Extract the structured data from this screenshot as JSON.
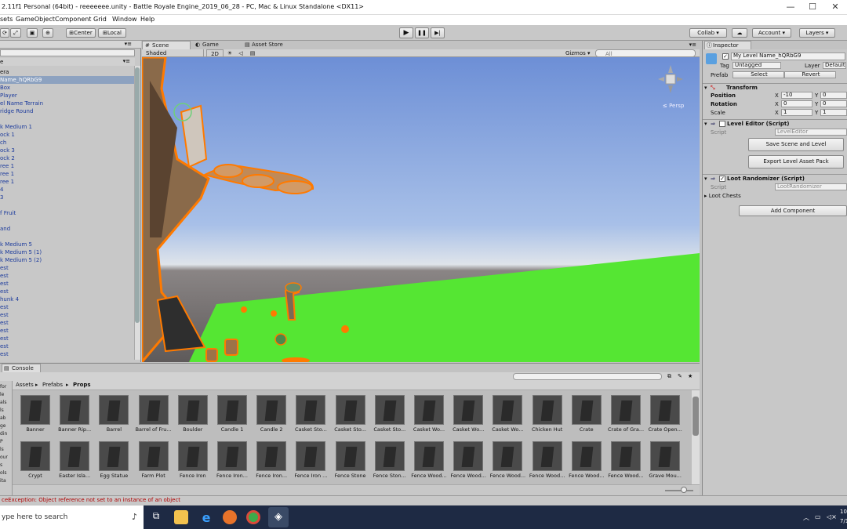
{
  "window": {
    "title": "2.11f1 Personal (64bit) - reeeeeee.unity - Battle Royale Engine_2019_06_28 - PC, Mac & Linux Standalone <DX11>",
    "min": "—",
    "max": "☐",
    "close": "✕"
  },
  "menu": [
    "sets",
    "GameObject",
    "Component",
    "Grid",
    "Window",
    "Help"
  ],
  "toolbar": {
    "center": "Center",
    "local": "Local",
    "play": "▶",
    "pause": "❚❚",
    "step": "▶|",
    "collab": "Collab ▾",
    "cloud": "☁",
    "account": "Account ▾",
    "layers": "Layers ▾"
  },
  "hierarchy": {
    "header": "e",
    "menu_glyph": "▾≡",
    "rows": [
      {
        "text": "era",
        "color": "black"
      },
      {
        "text": "Name_hQRbG9",
        "color": "selected"
      },
      {
        "text": "Box",
        "color": "blue"
      },
      {
        "text": "Player",
        "color": "blue"
      },
      {
        "text": "el Name Terrain",
        "color": "blue"
      },
      {
        "text": "ridge Round",
        "color": "blue"
      },
      {
        "text": "",
        "color": "blue"
      },
      {
        "text": "k Medium 1",
        "color": "blue"
      },
      {
        "text": "ock 1",
        "color": "blue"
      },
      {
        "text": "ch",
        "color": "blue"
      },
      {
        "text": "ock 3",
        "color": "blue"
      },
      {
        "text": "ock 2",
        "color": "blue"
      },
      {
        "text": "ree 1",
        "color": "blue"
      },
      {
        "text": "ree 1",
        "color": "blue"
      },
      {
        "text": "ree 1",
        "color": "blue"
      },
      {
        "text": "4",
        "color": "blue"
      },
      {
        "text": "3",
        "color": "blue"
      },
      {
        "text": "",
        "color": "blue"
      },
      {
        "text": "f Fruit",
        "color": "blue"
      },
      {
        "text": "",
        "color": "blue"
      },
      {
        "text": "and",
        "color": "blue"
      },
      {
        "text": "",
        "color": "blue"
      },
      {
        "text": "k Medium 5",
        "color": "blue"
      },
      {
        "text": "k Medium 5 (1)",
        "color": "blue"
      },
      {
        "text": "k Medium 5 (2)",
        "color": "blue"
      },
      {
        "text": "est",
        "color": "blue"
      },
      {
        "text": "est",
        "color": "blue"
      },
      {
        "text": "est",
        "color": "blue"
      },
      {
        "text": "est",
        "color": "blue"
      },
      {
        "text": "hunk 4",
        "color": "blue"
      },
      {
        "text": "est",
        "color": "blue"
      },
      {
        "text": "est",
        "color": "blue"
      },
      {
        "text": "est",
        "color": "blue"
      },
      {
        "text": "est",
        "color": "blue"
      },
      {
        "text": "est",
        "color": "blue"
      },
      {
        "text": "est",
        "color": "blue"
      },
      {
        "text": "est",
        "color": "blue"
      }
    ]
  },
  "scene": {
    "tabs": [
      {
        "label": "Scene",
        "icon": "#"
      },
      {
        "label": "Game",
        "icon": "◐"
      },
      {
        "label": "Asset Store",
        "icon": "▤"
      }
    ],
    "shading": "Shaded",
    "mode2d": "2D",
    "gizmos": "Gizmos ▾",
    "search_placeholder": "All",
    "persp": "≤ Persp"
  },
  "inspector": {
    "tab": "Inspector",
    "object_name": "My Level Name_hQRbG9",
    "tag_label": "Tag",
    "tag_value": "Untagged",
    "layer_label": "Layer",
    "layer_value": "Default",
    "prefab_label": "Prefab",
    "prefab_select": "Select",
    "prefab_revert": "Revert",
    "transform": {
      "title": "Transform",
      "position": "Position",
      "rotation": "Rotation",
      "scale": "Scale",
      "pos_x": "-10",
      "pos_y": "0",
      "rot_x": "0",
      "rot_y": "0",
      "scl_x": "1",
      "scl_y": "1",
      "x": "X",
      "y": "Y"
    },
    "level_editor": {
      "title": "Level Editor (Script)",
      "script_label": "Script",
      "script_value": "LevelEditor",
      "save_button": "Save Scene and Level",
      "export_button": "Export Level Asset Pack"
    },
    "loot_randomizer": {
      "title": "Loot Randomizer (Script)",
      "script_label": "Script",
      "script_value": "LootRandomizer",
      "loot_chests": "Loot Chests"
    },
    "add_component": "Add Component"
  },
  "project": {
    "tab_console": "Console",
    "breadcrumb": [
      "Assets",
      "Prefabs",
      "Props"
    ],
    "left_labels": [
      "for",
      "le",
      "als",
      "ls",
      "ab",
      "ge",
      "din",
      "P",
      "ls",
      "our",
      "s",
      "ols",
      "ita"
    ],
    "row1": [
      "Banner",
      "Banner Rip...",
      "Barrel",
      "Barrel of Fru...",
      "Boulder",
      "Candle 1",
      "Candle 2",
      "Casket Sto...",
      "Casket Sto...",
      "Casket Sto...",
      "Casket Wo...",
      "Casket Wo...",
      "Casket Wo...",
      "Chicken Hut",
      "Crate",
      "Crate of Gra...",
      "Crate Open..."
    ],
    "row2": [
      "Crypt",
      "Easter Isla...",
      "Egg Statue",
      "Farm Plot",
      "Fence Iron",
      "Fence Iron...",
      "Fence Iron...",
      "Fence Iron ...",
      "Fence Stone",
      "Fence Ston...",
      "Fence Wood...",
      "Fence Wood...",
      "Fence Wood...",
      "Fence Wood...",
      "Fence Wood...",
      "Fence Wood...",
      "Grave Mou..."
    ]
  },
  "status": {
    "error": "ceException: Object reference not set to an instance of an object"
  },
  "taskbar": {
    "search": "ype here to search",
    "clock": "10:",
    "date": "7/1"
  },
  "colors": {
    "selection": "#8da2c0",
    "hierarchy_text": "#1b3a9c",
    "ground": "#55e633",
    "outline": "#ff7a00",
    "sky_top": "#6d8fd6",
    "error": "#b00000"
  }
}
